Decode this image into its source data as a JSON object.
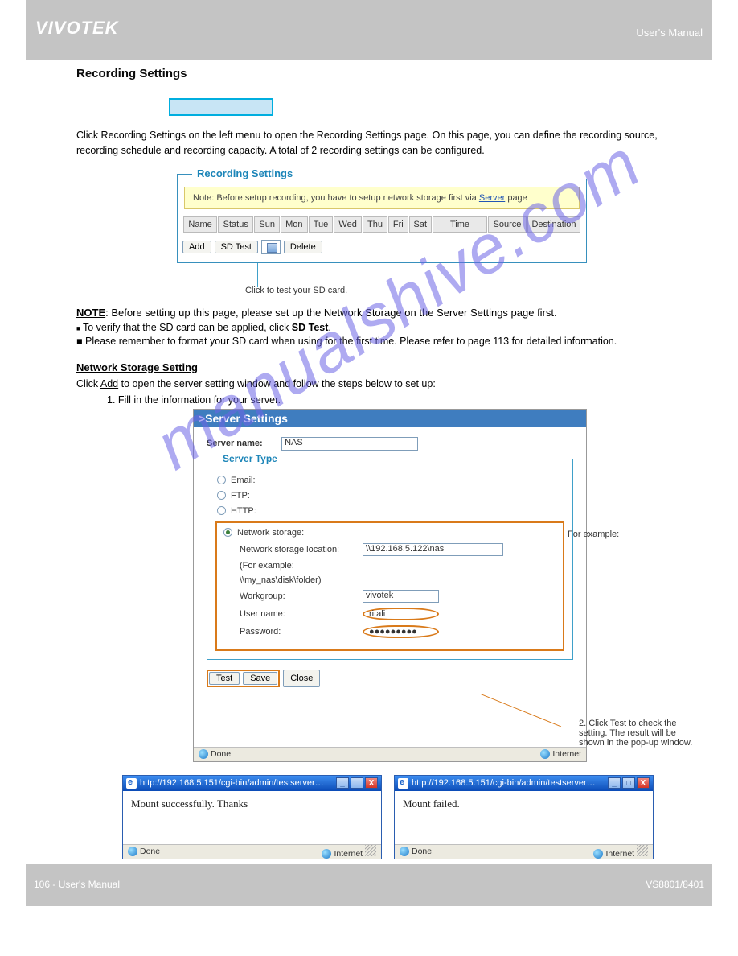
{
  "header": {
    "brand": "VIVOTEK",
    "manual": "User's Manual"
  },
  "recording_button_caption": "Recording Settings",
  "intro": "Click Recording Settings on the left menu to open the Recording Settings page. On this page, you can define the recording source, recording schedule and recording capacity. A total of 2 recording settings can be configured.",
  "rs": {
    "legend": "Recording Settings",
    "note_pre": "Note: Before setup recording, you have to setup network storage first via ",
    "note_link": "Server",
    "note_post": " page",
    "cols": [
      "Name",
      "Status",
      "Sun",
      "Mon",
      "Tue",
      "Wed",
      "Thu",
      "Fri",
      "Sat",
      "Time",
      "Source",
      "Destination"
    ],
    "btn_add": "Add",
    "btn_sd": "SD Test",
    "btn_delete": "Delete",
    "annot_sd": "Click to test your SD card."
  },
  "note_underline": "NOTE",
  "note_text": ": Before setting up this page, please set up the Network Storage on the Server Settings page first.",
  "li1": "To verify that the SD card can be applied, click ",
  "li1b": "SD Test",
  "li2": "■ Please remember to format your SD card when using for the first time. Please refer to page 113 for detailed information.",
  "netstorage_heading": "Network Storage Setting",
  "netstorage_sub_a": "Click ",
  "netstorage_sub_add": "Add",
  "netstorage_sub_b": " to open the server setting window and follow the steps below to set up:",
  "step1": "1. Fill in the information for your server.",
  "ss": {
    "title": ">Server Settings",
    "server_name_lbl": "Server name:",
    "server_name_val": "NAS",
    "legend": "Server Type",
    "r_email": "Email:",
    "r_ftp": "FTP:",
    "r_http": "HTTP:",
    "r_ns": "Network storage:",
    "nsl_lbl": "Network storage location:",
    "nsl_val": "\\\\192.168.5.122\\nas",
    "nsl_ex1": "(For example:",
    "nsl_ex2": "\\\\my_nas\\disk\\folder)",
    "wg_lbl": "Workgroup:",
    "wg_val": "vivotek",
    "un_lbl": "User name:",
    "un_val": "ritali",
    "pw_lbl": "Password:",
    "pw_val": "●●●●●●●●●",
    "btn_test": "Test",
    "btn_save": "Save",
    "btn_close": "Close",
    "status_done": "Done",
    "status_zone": "Internet"
  },
  "annot_loc": "For example:",
  "annot_user": "2. Click Test to check the setting. The result will be shown in the pop-up window.",
  "popup": {
    "url": "http://192.168.5.151/cgi-bin/admin/testserver…",
    "msg_ok": "Mount successfully. Thanks",
    "msg_fail": "Mount failed.",
    "done": "Done",
    "zone": "Internet"
  },
  "footer": {
    "page": "106",
    "model": "VS8801/8401"
  }
}
